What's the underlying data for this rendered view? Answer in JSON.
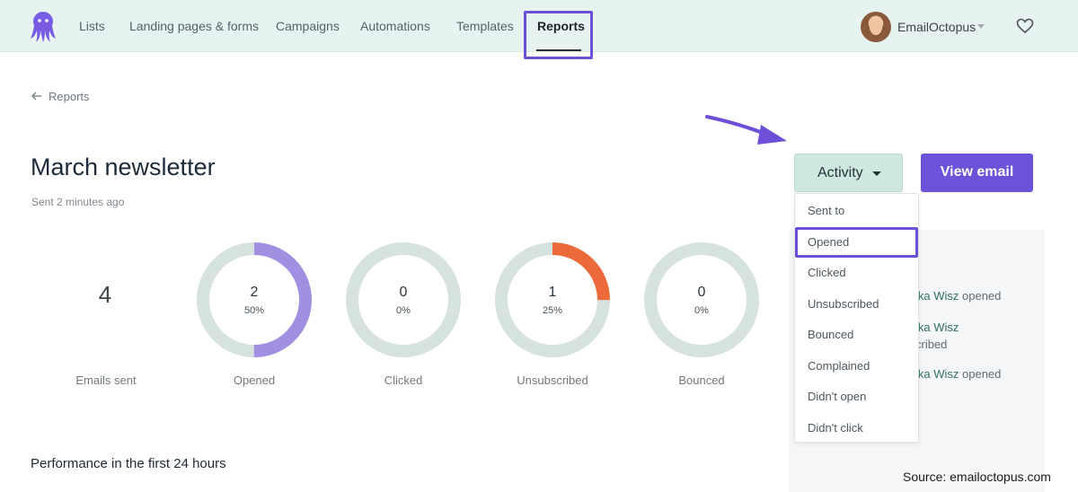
{
  "nav": {
    "items": [
      {
        "label": "Lists"
      },
      {
        "label": "Landing pages & forms"
      },
      {
        "label": "Campaigns"
      },
      {
        "label": "Automations"
      },
      {
        "label": "Templates"
      },
      {
        "label": "Reports",
        "active": true
      }
    ],
    "account_name": "EmailOctopus"
  },
  "breadcrumb": {
    "label": "Reports"
  },
  "title": "March newsletter",
  "sent_time": "Sent 2 minutes ago",
  "stats": {
    "emails_sent": {
      "value": "4",
      "label": "Emails sent"
    },
    "rings": [
      {
        "value": "2",
        "percent": "50%",
        "fraction": 0.5,
        "label": "Opened",
        "color": "#a18fe1"
      },
      {
        "value": "0",
        "percent": "0%",
        "fraction": 0,
        "label": "Clicked",
        "color": "#a18fe1"
      },
      {
        "value": "1",
        "percent": "25%",
        "fraction": 0.25,
        "label": "Unsubscribed",
        "color": "#ec6a3a"
      },
      {
        "value": "0",
        "percent": "0%",
        "fraction": 0,
        "label": "Bounced",
        "color": "#a18fe1"
      }
    ],
    "track_color": "#d6e2de"
  },
  "buttons": {
    "activity": "Activity",
    "view_email": "View email"
  },
  "dropdown": {
    "items": [
      {
        "label": "Sent to"
      },
      {
        "label": "Opened",
        "highlighted": true
      },
      {
        "label": "Clicked"
      },
      {
        "label": "Unsubscribed"
      },
      {
        "label": "Bounced"
      },
      {
        "label": "Complained"
      },
      {
        "label": "Didn't open"
      },
      {
        "label": "Didn't click"
      }
    ]
  },
  "activity_feed": [
    {
      "name": "ika Wisz",
      "action": "opened"
    },
    {
      "name": "ika Wisz",
      "action": "cribed"
    },
    {
      "name": "ika Wisz",
      "action": "opened"
    }
  ],
  "performance_heading": "Performance in the first 24 hours",
  "source_credit": "Source:  emailoctopus.com",
  "colors": {
    "accent": "#6b52d8",
    "nav_bg": "#e7f3f0",
    "activity_button_bg": "#cfe8df",
    "highlight": "#6b4fd6"
  }
}
